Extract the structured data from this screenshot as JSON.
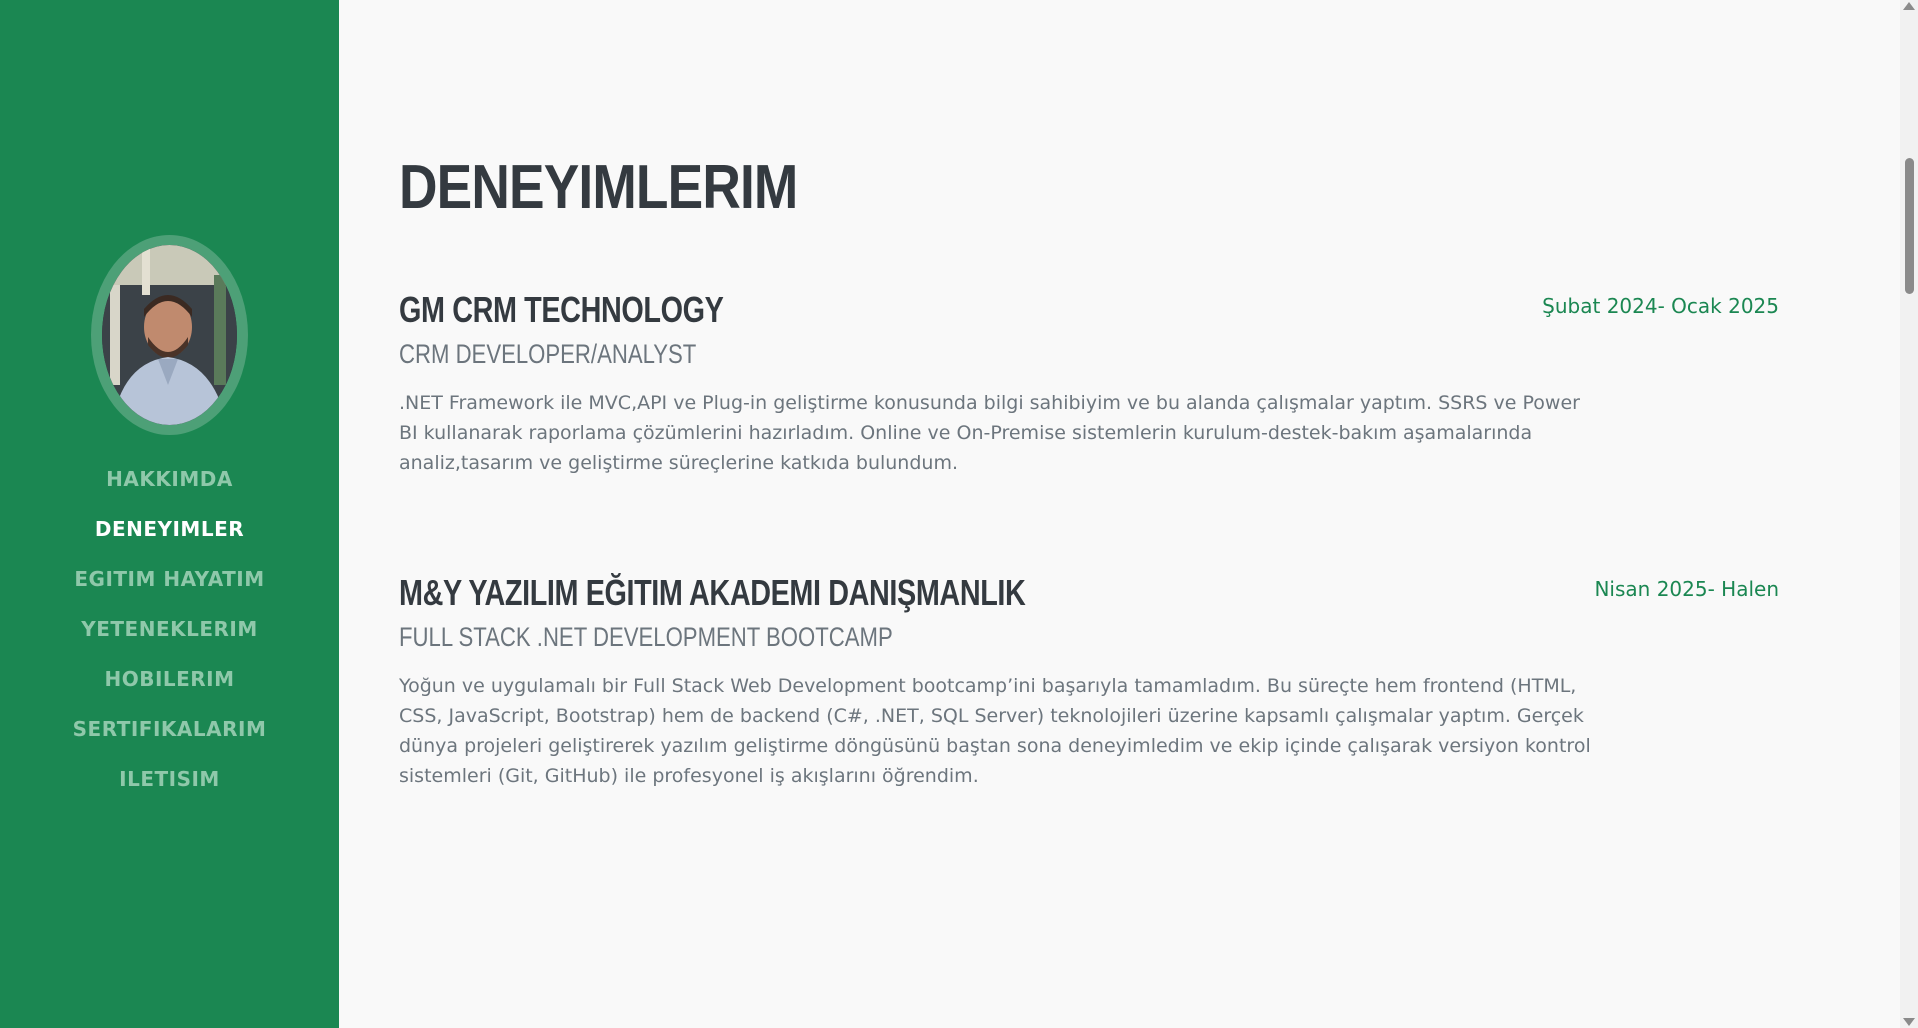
{
  "sidebar": {
    "nav": [
      {
        "label": "HAKKIMDA",
        "active": false
      },
      {
        "label": "DENEYIMLER",
        "active": true
      },
      {
        "label": "EGITIM HAYATIM",
        "active": false
      },
      {
        "label": "YETENEKLERIM",
        "active": false
      },
      {
        "label": "HOBILERIM",
        "active": false
      },
      {
        "label": "SERTIFIKALARIM",
        "active": false
      },
      {
        "label": "ILETISIM",
        "active": false
      }
    ],
    "colors": {
      "background": "#1b8752",
      "active": "#ffffff",
      "inactive": "#8fc8aa"
    }
  },
  "main": {
    "title": "DENEYIMLERIM",
    "experiences": [
      {
        "company": "GM CRM TECHNOLOGY",
        "role": "CRM DEVELOPER/ANALYST",
        "date": "Şubat 2024- Ocak 2025",
        "description": ".NET Framework ile MVC,API ve Plug-in geliştirme konusunda bilgi sahibiyim ve bu alanda çalışmalar yaptım. SSRS ve Power BI kullanarak raporlama çözümlerini hazırladım. Online ve On-Premise sistemlerin kurulum-destek-bakım aşamalarında analiz,tasarım ve geliştirme süreçlerine katkıda bulundum."
      },
      {
        "company": "M&Y YAZILIM EĞITIM AKADEMI DANIŞMANLIK",
        "role": "FULL STACK .NET DEVELOPMENT BOOTCAMP",
        "date": "Nisan 2025- Halen",
        "description": "Yoğun ve uygulamalı bir Full Stack Web Development bootcamp’ini başarıyla tamamladım. Bu süreçte hem frontend (HTML, CSS, JavaScript, Bootstrap) hem de backend (C#, .NET, SQL Server) teknolojileri üzerine kapsamlı çalışmalar yaptım. Gerçek dünya projeleri geliştirerek yazılım geliştirme döngüsünü baştan sona deneyimledim ve ekip içinde çalışarak versiyon kontrol sistemleri (Git, GitHub) ile profesyonel iş akışlarını öğrendim."
      }
    ],
    "colors": {
      "accent": "#1b8752",
      "heading": "#343a40",
      "muted": "#6c757d"
    }
  }
}
